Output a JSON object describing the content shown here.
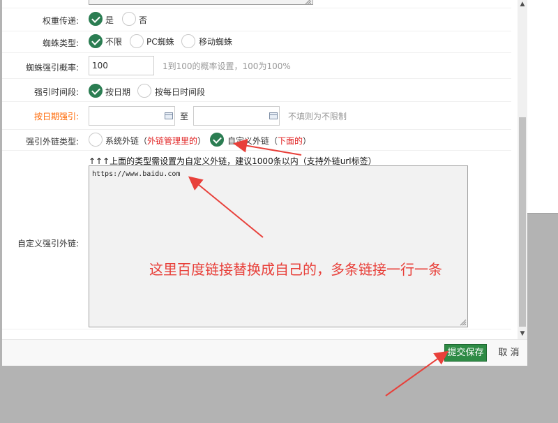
{
  "form": {
    "weight": {
      "label": "权重传递:",
      "options": [
        "是",
        "否"
      ],
      "selected": 0
    },
    "spider_type": {
      "label": "蜘蛛类型:",
      "options": [
        "不限",
        "PC蜘蛛",
        "移动蜘蛛"
      ],
      "selected": 0
    },
    "spider_prob": {
      "label": "蜘蛛强引概率:",
      "value": "100",
      "hint": "1到100的概率设置，100为100%"
    },
    "time_period": {
      "label": "强引时间段:",
      "options": [
        "按日期",
        "按每日时间段"
      ],
      "selected": 0
    },
    "date_range": {
      "label": "按日期强引:",
      "to": "至",
      "hint": "不填则为不限制"
    },
    "link_type": {
      "label": "强引外链类型:",
      "option1": "系统外链（",
      "option1_note": "外链管理里的",
      "option1_end": "）",
      "option2": "自定义外链（",
      "option2_note": "下面的",
      "option2_end": "）",
      "selected": 1
    },
    "custom_links": {
      "label": "自定义强引外链:",
      "note": "↑↑↑上面的类型需设置为自定义外链，建议1000条以内（支持外链url标签）",
      "value": "https://www.baidu.com"
    }
  },
  "annotation": "这里百度链接替换成自己的，多条链接一行一条",
  "footer": {
    "submit": "提交保存",
    "cancel": "取 消"
  },
  "colors": {
    "accent": "#2b7d52",
    "annotation": "#e8403a",
    "orange_label": "#ff6600",
    "red_note": "#e02020",
    "submit_bg": "#2e8b45"
  },
  "icons": {
    "calendar": "calendar-icon",
    "resize": "resize-grip-icon",
    "check": "check-icon"
  }
}
